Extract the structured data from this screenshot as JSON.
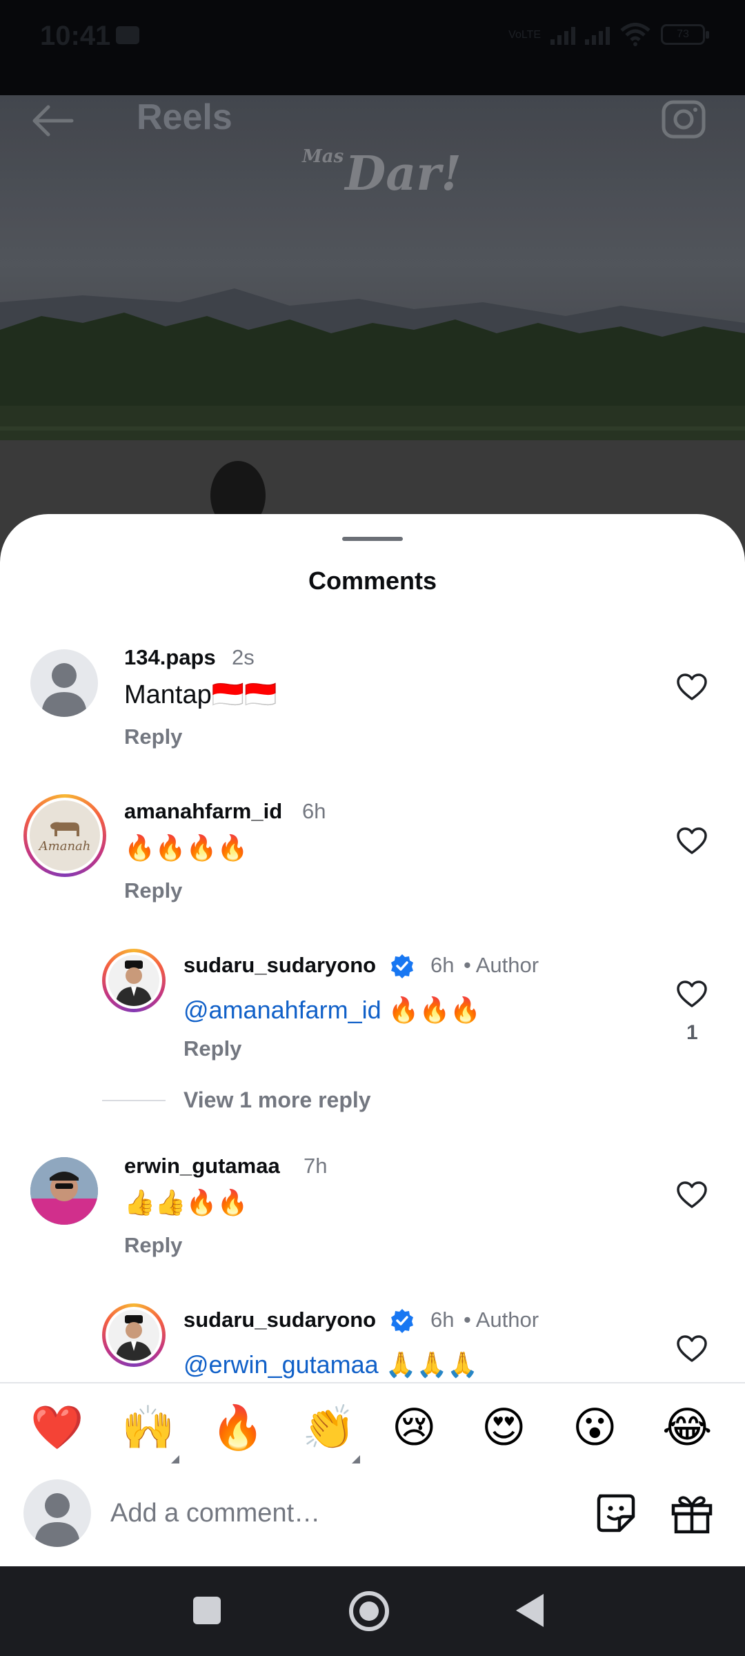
{
  "status_bar": {
    "time": "10:41",
    "network_label": "VoLTE",
    "battery": "73"
  },
  "header": {
    "title": "Reels",
    "back_icon": "arrow-left-icon",
    "camera_icon": "camera-icon"
  },
  "video": {
    "watermark_prefix": "Mas",
    "watermark": "Dar!"
  },
  "sheet": {
    "title": "Comments"
  },
  "comments": [
    {
      "username": "134.paps",
      "time": "2s",
      "text": "Mantap🇮🇩🇮🇩",
      "reply_label": "Reply"
    },
    {
      "username": "amanahfarm_id",
      "time": "6h",
      "text": "🔥🔥🔥🔥",
      "reply_label": "Reply",
      "avatar_text": "Amanah"
    },
    {
      "username": "sudaru_sudaryono",
      "time": "6h",
      "author_label": "• Author",
      "mention": "@amanahfarm_id",
      "text": " 🔥🔥🔥",
      "reply_label": "Reply",
      "likes": "1"
    },
    {
      "view_more_label": "View 1 more reply"
    },
    {
      "username": "erwin_gutamaa",
      "time": "7h",
      "text": "👍👍🔥🔥",
      "reply_label": "Reply"
    },
    {
      "username": "sudaru_sudaryono",
      "time": "6h",
      "author_label": "• Author",
      "mention": "@erwin_gutamaa",
      "text": " 🙏🙏🙏"
    }
  ],
  "emoji_bar": [
    "❤️",
    "🙌",
    "🔥",
    "👏",
    "😢",
    "😍",
    "😮",
    "😂"
  ],
  "composer": {
    "placeholder": "Add a comment…",
    "sticker_icon": "sticker-icon",
    "gift_icon": "gift-icon"
  },
  "colors": {
    "mention": "#1060c8",
    "verified": "#1877f2",
    "muted_text": "#737780"
  }
}
